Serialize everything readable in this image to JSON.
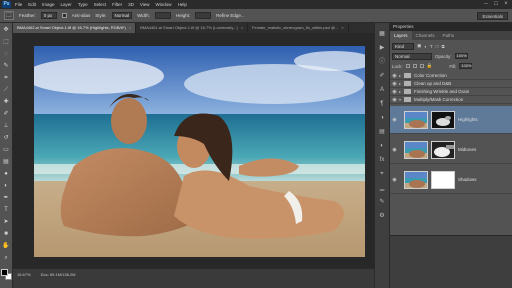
{
  "menubar": {
    "app_icon": "Ps",
    "items": [
      "File",
      "Edit",
      "Image",
      "Layer",
      "Type",
      "Select",
      "Filter",
      "3D",
      "View",
      "Window",
      "Help"
    ]
  },
  "options": {
    "feather_label": "Feather:",
    "feather_value": "0 px",
    "anti_alias_label": "Anti-alias",
    "style_label": "Style:",
    "style_value": "Normal",
    "width_label": "Width:",
    "height_label": "Height:",
    "refine_edge_label": "Refine Edge...",
    "workspace_value": "Essentials"
  },
  "tabs": [
    {
      "label": "BMA4462.ai Smart Object-1.tif @ 16.7% (Highlights, RGB/8*)",
      "active": true
    },
    {
      "label": "BMA4461.ai Smart Object-1.tif @ 16.7% (Luminosity...)",
      "active": false
    },
    {
      "label": "Female_realistic_stereogram_fix_within.psd @...",
      "active": false
    }
  ],
  "status": {
    "zoom": "16.67%",
    "doc_info": "Doc: 69.1M/138.2M"
  },
  "properties_panel": {
    "title": "Properties"
  },
  "layers_panel": {
    "tabs": [
      "Layers",
      "Channels",
      "Paths"
    ],
    "filter_label": "Kind",
    "blend_mode": "Normal",
    "opacity_label": "Opacity:",
    "opacity_value": "100%",
    "lock_label": "Lock:",
    "fill_label": "Fill:",
    "fill_value": "100%",
    "groups": [
      {
        "name": "Color Correction"
      },
      {
        "name": "Clean up and D&B"
      },
      {
        "name": "Finishing Wrinkle and Grain"
      },
      {
        "name": "Multiply/Mask Correction"
      }
    ],
    "layers": [
      {
        "name": "Highlights",
        "selected": true
      },
      {
        "name": "Midtones",
        "selected": false
      },
      {
        "name": "Shadows",
        "selected": false
      }
    ]
  },
  "colors": {
    "chrome": "#535353",
    "dark": "#282828",
    "selection": "#5e7a98"
  }
}
